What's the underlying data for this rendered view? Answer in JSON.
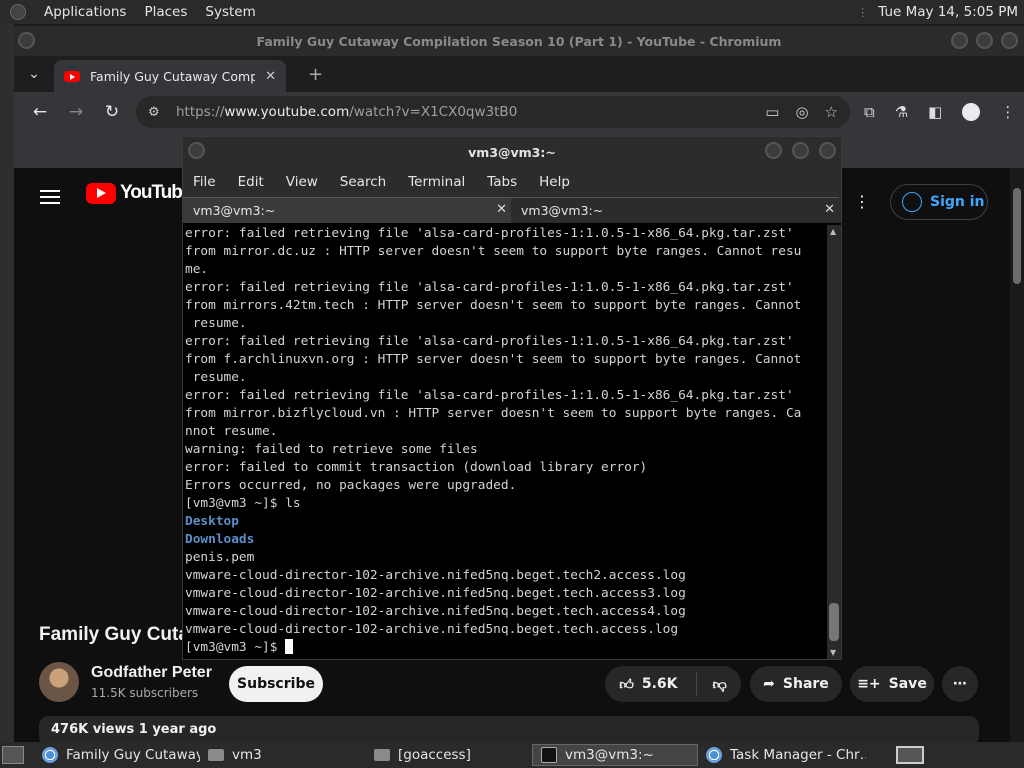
{
  "top_panel": {
    "menus": [
      "Applications",
      "Places",
      "System"
    ],
    "clock": "Tue May 14,  5:05 PM"
  },
  "chromium": {
    "window_title": "Family Guy Cutaway Compilation Season 10 (Part 1) - YouTube - Chromium",
    "tab_title": "Family Guy Cutaway Compil",
    "url_prefix": "https://",
    "url_host": "www.youtube.com",
    "url_path": "/watch?v=X1CX0qw3tB0"
  },
  "youtube": {
    "wordmark": "YouTube",
    "sign_in": "Sign in",
    "video_title": "Family Guy Cuta",
    "channel_name": "Godfather Peter",
    "subscribers": "11.5K subscribers",
    "subscribe": "Subscribe",
    "likes": "5.6K",
    "share": "Share",
    "save": "Save",
    "views_line": "476K views  1 year ago"
  },
  "terminal": {
    "title": "vm3@vm3:~",
    "menu": [
      "File",
      "Edit",
      "View",
      "Search",
      "Terminal",
      "Tabs",
      "Help"
    ],
    "tabs": [
      "vm3@vm3:~",
      "vm3@vm3:~"
    ],
    "lines": [
      {
        "text": "error: failed retrieving file 'alsa-card-profiles-1:1.0.5-1-x86_64.pkg.tar.zst'",
        "style": "normal"
      },
      {
        "text": "from mirror.dc.uz : HTTP server doesn't seem to support byte ranges. Cannot resu",
        "style": "normal"
      },
      {
        "text": "me.",
        "style": "normal"
      },
      {
        "text": "error: failed retrieving file 'alsa-card-profiles-1:1.0.5-1-x86_64.pkg.tar.zst'",
        "style": "normal"
      },
      {
        "text": "from mirrors.42tm.tech : HTTP server doesn't seem to support byte ranges. Cannot",
        "style": "normal"
      },
      {
        "text": " resume.",
        "style": "normal"
      },
      {
        "text": "error: failed retrieving file 'alsa-card-profiles-1:1.0.5-1-x86_64.pkg.tar.zst'",
        "style": "normal"
      },
      {
        "text": "from f.archlinuxvn.org : HTTP server doesn't seem to support byte ranges. Cannot",
        "style": "normal"
      },
      {
        "text": " resume.",
        "style": "normal"
      },
      {
        "text": "error: failed retrieving file 'alsa-card-profiles-1:1.0.5-1-x86_64.pkg.tar.zst'",
        "style": "normal"
      },
      {
        "text": "from mirror.bizflycloud.vn : HTTP server doesn't seem to support byte ranges. Ca",
        "style": "normal"
      },
      {
        "text": "nnot resume.",
        "style": "normal"
      },
      {
        "text": "warning: failed to retrieve some files",
        "style": "normal"
      },
      {
        "text": "error: failed to commit transaction (download library error)",
        "style": "normal"
      },
      {
        "text": "Errors occurred, no packages were upgraded.",
        "style": "normal"
      },
      {
        "text": "[vm3@vm3 ~]$ ls",
        "style": "normal"
      },
      {
        "text": "Desktop",
        "style": "dir"
      },
      {
        "text": "Downloads",
        "style": "dir"
      },
      {
        "text": "penis.pem",
        "style": "normal"
      },
      {
        "text": "vmware-cloud-director-102-archive.nifed5nq.beget.tech2.access.log",
        "style": "normal"
      },
      {
        "text": "vmware-cloud-director-102-archive.nifed5nq.beget.tech.access3.log",
        "style": "normal"
      },
      {
        "text": "vmware-cloud-director-102-archive.nifed5nq.beget.tech.access4.log",
        "style": "normal"
      },
      {
        "text": "vmware-cloud-director-102-archive.nifed5nq.beget.tech.access.log",
        "style": "normal"
      }
    ],
    "prompt": "[vm3@vm3 ~]$ "
  },
  "taskbar": {
    "tasks": [
      {
        "label": "Family Guy Cutaway…",
        "icon": "chrome-icon",
        "active": false
      },
      {
        "label": "vm3",
        "icon": "folder-icon",
        "active": false
      },
      {
        "label": "[goaccess]",
        "icon": "folder-icon",
        "active": false
      },
      {
        "label": "vm3@vm3:~",
        "icon": "terminal-icon",
        "active": true
      },
      {
        "label": "Task Manager - Chr…",
        "icon": "chrome-icon",
        "active": false
      }
    ]
  }
}
